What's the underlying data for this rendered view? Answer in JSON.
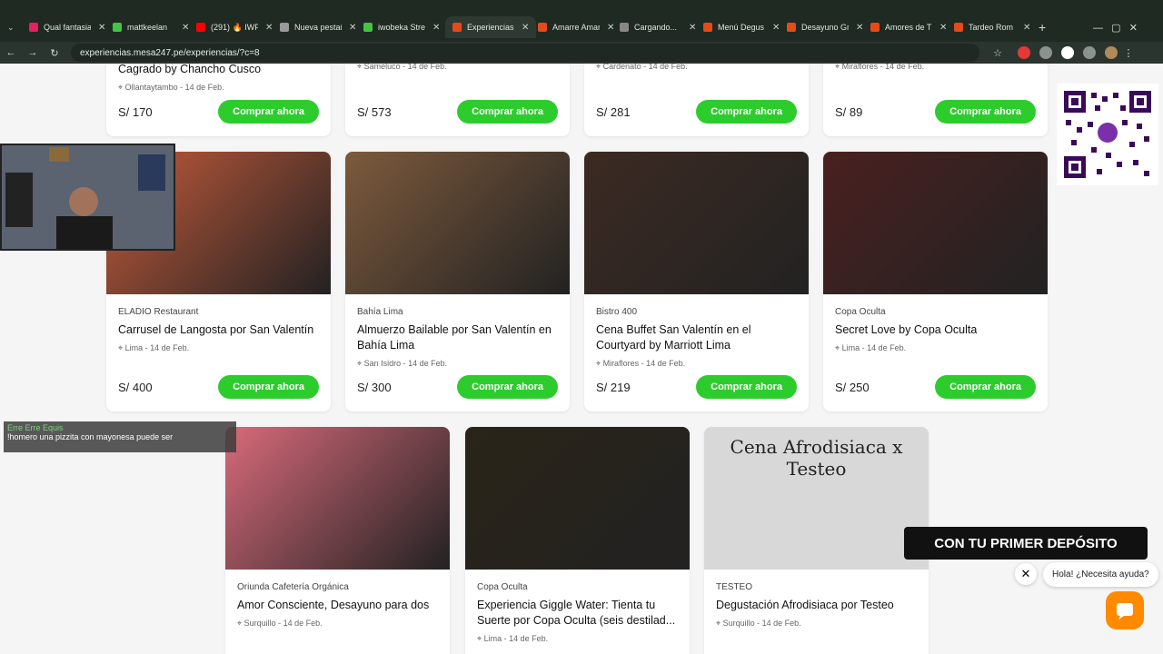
{
  "tabs": [
    {
      "label": "Qual fantasia",
      "color": "#e91e63"
    },
    {
      "label": "mattkeelan",
      "color": "#43c543"
    },
    {
      "label": "(291) 🔥 IWF",
      "color": "#ff0000"
    },
    {
      "label": "Nueva pestaña",
      "color": "#999999"
    },
    {
      "label": "iwobeka Stream",
      "color": "#43c543"
    },
    {
      "label": "Experiencias",
      "color": "#e64a19"
    },
    {
      "label": "Amarre Amarre",
      "color": "#e64a19"
    },
    {
      "label": "Cargando...",
      "color": "#888888"
    },
    {
      "label": "Menú Degus",
      "color": "#e64a19"
    },
    {
      "label": "Desayuno Gr",
      "color": "#e64a19"
    },
    {
      "label": "Amores de T",
      "color": "#e64a19"
    },
    {
      "label": "Tardeo Rom",
      "color": "#e64a19"
    }
  ],
  "url": "experiencias.mesa247.pe/experiencias/?c=8",
  "toprow": [
    {
      "title": "Cagrado by Chancho Cusco",
      "location": "Ollantaytambo - 14 de Feb.",
      "price": "S/ 170"
    },
    {
      "location": "Sameluco - 14 de Feb.",
      "price": "S/ 573"
    },
    {
      "location": "Cardenato - 14 de Feb.",
      "price": "S/ 281"
    },
    {
      "location": "Miraflores - 14 de Feb.",
      "price": "S/ 89"
    }
  ],
  "row2": [
    {
      "restaurant": "ELADIO Restaurant",
      "title": "Carrusel de Langosta por San Valentín",
      "location": "Lima - 14 de Feb.",
      "price": "S/ 400",
      "img": "#c65b3a"
    },
    {
      "restaurant": "Bahía Lima",
      "title": "Almuerzo Bailable por San Valentín en Bahía Lima",
      "location": "San Isidro - 14 de Feb.",
      "price": "S/ 300",
      "img": "#7d5a3c"
    },
    {
      "restaurant": "Bistro 400",
      "title": "Cena Buffet San Valentín en el Courtyard by Marriott Lima",
      "location": "Miraflores - 14 de Feb.",
      "price": "S/ 219",
      "img": "#3c2a22"
    },
    {
      "restaurant": "Copa Oculta",
      "title": "Secret Love by Copa Oculta",
      "location": "Lima - 14 de Feb.",
      "price": "S/ 250",
      "img": "#4a2020"
    }
  ],
  "row3": [
    {
      "restaurant": "Oriunda Cafetería Orgánica",
      "title": "Amor Consciente, Desayuno para dos",
      "location": "Surquillo - 14 de Feb.",
      "img": "#d86a7a"
    },
    {
      "restaurant": "Copa Oculta",
      "title": "Experiencia Giggle Water: Tienta tu Suerte por Copa Oculta (seis destilad...",
      "location": "Lima - 14 de Feb.",
      "img": "#2a2418"
    },
    {
      "restaurant": "TESTEO",
      "title": "Degustación Afrodisiaca por Testeo",
      "location": "Surquillo - 14 de Feb.",
      "img": "#cfcfcf",
      "img_text": "Cena Afrodisiaca x Testeo"
    }
  ],
  "buy_label": "Comprar ahora",
  "chat": {
    "user": "Erre Erre Equis",
    "message": "!homero una pizzita con mayonesa puede ser"
  },
  "promo": "CON TU PRIMER DEPÓSITO",
  "help": "Hola! ¿Necesita ayuda?",
  "colors": {
    "buy": "#2dcc2d",
    "chat_btn": "#ff8a00"
  }
}
